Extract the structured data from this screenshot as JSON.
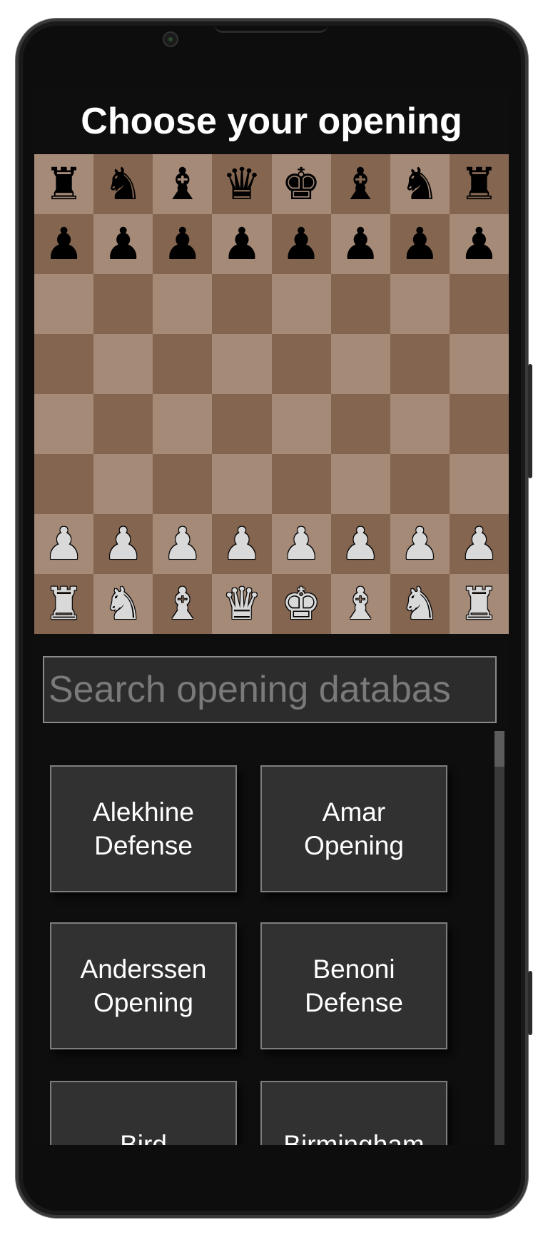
{
  "title": "Choose your opening",
  "search": {
    "placeholder": "Search opening databas"
  },
  "board": {
    "ranks": [
      [
        {
          "p": "♜",
          "c": "black",
          "n": "black-rook"
        },
        {
          "p": "♞",
          "c": "black",
          "n": "black-knight"
        },
        {
          "p": "♝",
          "c": "black",
          "n": "black-bishop"
        },
        {
          "p": "♛",
          "c": "black",
          "n": "black-queen"
        },
        {
          "p": "♚",
          "c": "black",
          "n": "black-king"
        },
        {
          "p": "♝",
          "c": "black",
          "n": "black-bishop"
        },
        {
          "p": "♞",
          "c": "black",
          "n": "black-knight"
        },
        {
          "p": "♜",
          "c": "black",
          "n": "black-rook"
        }
      ],
      [
        {
          "p": "♟",
          "c": "black",
          "n": "black-pawn"
        },
        {
          "p": "♟",
          "c": "black",
          "n": "black-pawn"
        },
        {
          "p": "♟",
          "c": "black",
          "n": "black-pawn"
        },
        {
          "p": "♟",
          "c": "black",
          "n": "black-pawn"
        },
        {
          "p": "♟",
          "c": "black",
          "n": "black-pawn"
        },
        {
          "p": "♟",
          "c": "black",
          "n": "black-pawn"
        },
        {
          "p": "♟",
          "c": "black",
          "n": "black-pawn"
        },
        {
          "p": "♟",
          "c": "black",
          "n": "black-pawn"
        }
      ],
      [
        null,
        null,
        null,
        null,
        null,
        null,
        null,
        null
      ],
      [
        null,
        null,
        null,
        null,
        null,
        null,
        null,
        null
      ],
      [
        null,
        null,
        null,
        null,
        null,
        null,
        null,
        null
      ],
      [
        null,
        null,
        null,
        null,
        null,
        null,
        null,
        null
      ],
      [
        {
          "p": "♟",
          "c": "white",
          "n": "white-pawn"
        },
        {
          "p": "♟",
          "c": "white",
          "n": "white-pawn"
        },
        {
          "p": "♟",
          "c": "white",
          "n": "white-pawn"
        },
        {
          "p": "♟",
          "c": "white",
          "n": "white-pawn"
        },
        {
          "p": "♟",
          "c": "white",
          "n": "white-pawn"
        },
        {
          "p": "♟",
          "c": "white",
          "n": "white-pawn"
        },
        {
          "p": "♟",
          "c": "white",
          "n": "white-pawn"
        },
        {
          "p": "♟",
          "c": "white",
          "n": "white-pawn"
        }
      ],
      [
        {
          "p": "♜",
          "c": "white",
          "n": "white-rook"
        },
        {
          "p": "♞",
          "c": "white",
          "n": "white-knight"
        },
        {
          "p": "♝",
          "c": "white",
          "n": "white-bishop"
        },
        {
          "p": "♛",
          "c": "white",
          "n": "white-queen"
        },
        {
          "p": "♚",
          "c": "white",
          "n": "white-king"
        },
        {
          "p": "♝",
          "c": "white",
          "n": "white-bishop"
        },
        {
          "p": "♞",
          "c": "white",
          "n": "white-knight"
        },
        {
          "p": "♜",
          "c": "white",
          "n": "white-rook"
        }
      ]
    ],
    "light_color": "#a58a78",
    "dark_color": "#836550"
  },
  "openings": [
    {
      "label": "Alekhine Defense"
    },
    {
      "label": "Amar Opening"
    },
    {
      "label": "Anderssen Opening"
    },
    {
      "label": "Benoni Defense"
    },
    {
      "label": "Bird"
    },
    {
      "label": "Birmingham"
    }
  ]
}
